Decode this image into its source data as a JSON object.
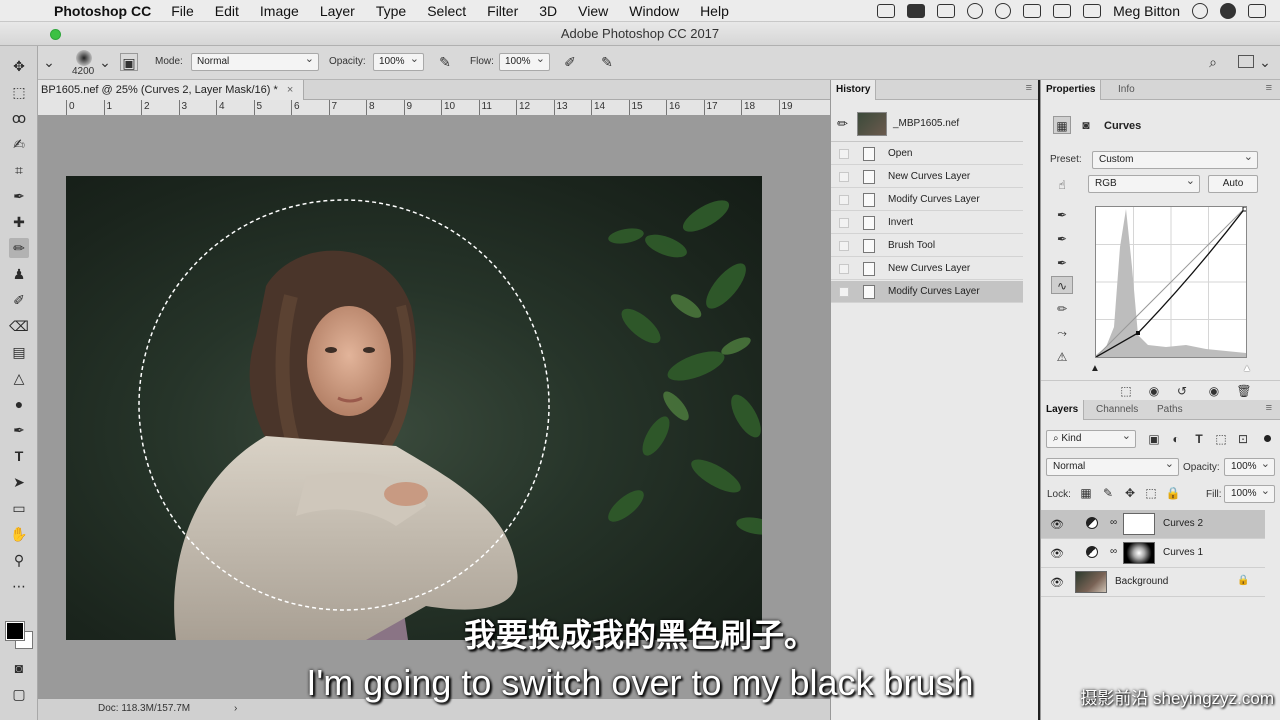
{
  "menubar": {
    "app_name": "Photoshop CC",
    "items": [
      "File",
      "Edit",
      "Image",
      "Layer",
      "Type",
      "Select",
      "Filter",
      "3D",
      "View",
      "Window",
      "Help"
    ],
    "user": "Meg Bitton"
  },
  "window": {
    "title": "Adobe Photoshop CC 2017"
  },
  "options": {
    "brush_size": "4200",
    "mode_label": "Mode:",
    "mode_value": "Normal",
    "opacity_label": "Opacity:",
    "opacity_value": "100%",
    "flow_label": "Flow:",
    "flow_value": "100%"
  },
  "document": {
    "tab_title": "BP1605.nef @ 25% (Curves 2, Layer Mask/16) *",
    "ruler_numbers": [
      "0",
      "1",
      "2",
      "3",
      "4",
      "5",
      "6",
      "7",
      "8",
      "9",
      "10",
      "11",
      "12",
      "13",
      "14",
      "15",
      "16",
      "17",
      "18",
      "19"
    ],
    "doc_info": "Doc: 118.3M/157.7M"
  },
  "history": {
    "tab": "History",
    "snapshot_name": "_MBP1605.nef",
    "steps": [
      "Open",
      "New Curves Layer",
      "Modify Curves Layer",
      "Invert",
      "Brush Tool",
      "New Curves Layer",
      "Modify Curves Layer"
    ],
    "selected_index": 6
  },
  "properties": {
    "tabs": [
      "Properties",
      "Info"
    ],
    "title": "Curves",
    "preset_label": "Preset:",
    "preset_value": "Custom",
    "channel_value": "RGB",
    "auto_label": "Auto"
  },
  "layers": {
    "tabs": [
      "Layers",
      "Channels",
      "Paths"
    ],
    "filter_kind": "Kind",
    "blend_mode": "Normal",
    "opacity_label": "Opacity:",
    "opacity_value": "100%",
    "lock_label": "Lock:",
    "fill_label": "Fill:",
    "fill_value": "100%",
    "items": [
      {
        "name": "Curves 2",
        "type": "adjustment",
        "selected": true
      },
      {
        "name": "Curves 1",
        "type": "adjustment",
        "selected": false
      },
      {
        "name": "Background",
        "type": "image",
        "selected": false
      }
    ]
  },
  "subtitles": {
    "chinese": "我要换成我的黑色刷子。",
    "english": "I'm going to switch over to my black brush"
  },
  "watermark": "摄影前沿 sheyingzyz.com",
  "colors": {
    "foreground": "#000000",
    "background": "#ffffff",
    "selected_row": "#c4c4c4",
    "panel_bg": "#e9e9e9"
  }
}
